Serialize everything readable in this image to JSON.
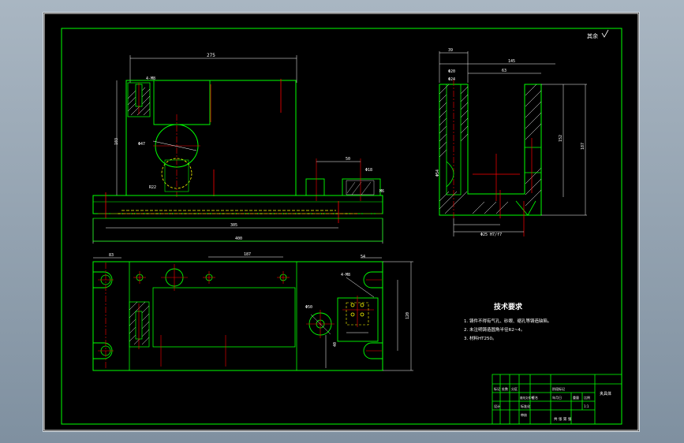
{
  "roughness_note": "其余",
  "tech_req": {
    "title": "技术要求",
    "items": [
      "1. 铸件不得有气孔、砂眼、缩孔等铸造缺陷。",
      "2. 未注明铸造圆角半径R2~4。",
      "3. 材料HT250。"
    ]
  },
  "title_block": {
    "labels": [
      "夹具体",
      "标记",
      "处数",
      "分区",
      "更改文件号",
      "签名",
      "年月日",
      "设计",
      "标准化",
      "阶段标记",
      "重量",
      "比例",
      "1:1",
      "审核",
      "共 张 第 张"
    ]
  },
  "dims": {
    "front_top": "275",
    "front_left_h": "103",
    "front_bottom_mid": "305",
    "front_bottom_total": "400",
    "front_dia": "Φ47",
    "front_r": "R22",
    "front_hole": "4-M8",
    "front_small": "Φ18",
    "front_step": "50",
    "front_m": "M6",
    "side_top": "39",
    "side_top2": "145",
    "side_63": "63",
    "side_20": "Φ20",
    "side_24": "Φ24",
    "side_h1": "152",
    "side_h2": "187",
    "side_d": "Φ54",
    "side_bottom": "Φ25 H7/f7",
    "plan_left": "83",
    "plan_mid": "187",
    "plan_r": "4-M8",
    "plan_h": "120",
    "plan_w": "54",
    "plan_d": "Φ50",
    "plan_side": "40"
  },
  "colors": {
    "outline": "#00ff00",
    "center": "#ff0000",
    "dim": "#ffffff",
    "hidden": "#ffff00",
    "hatch": "#ffffff"
  }
}
